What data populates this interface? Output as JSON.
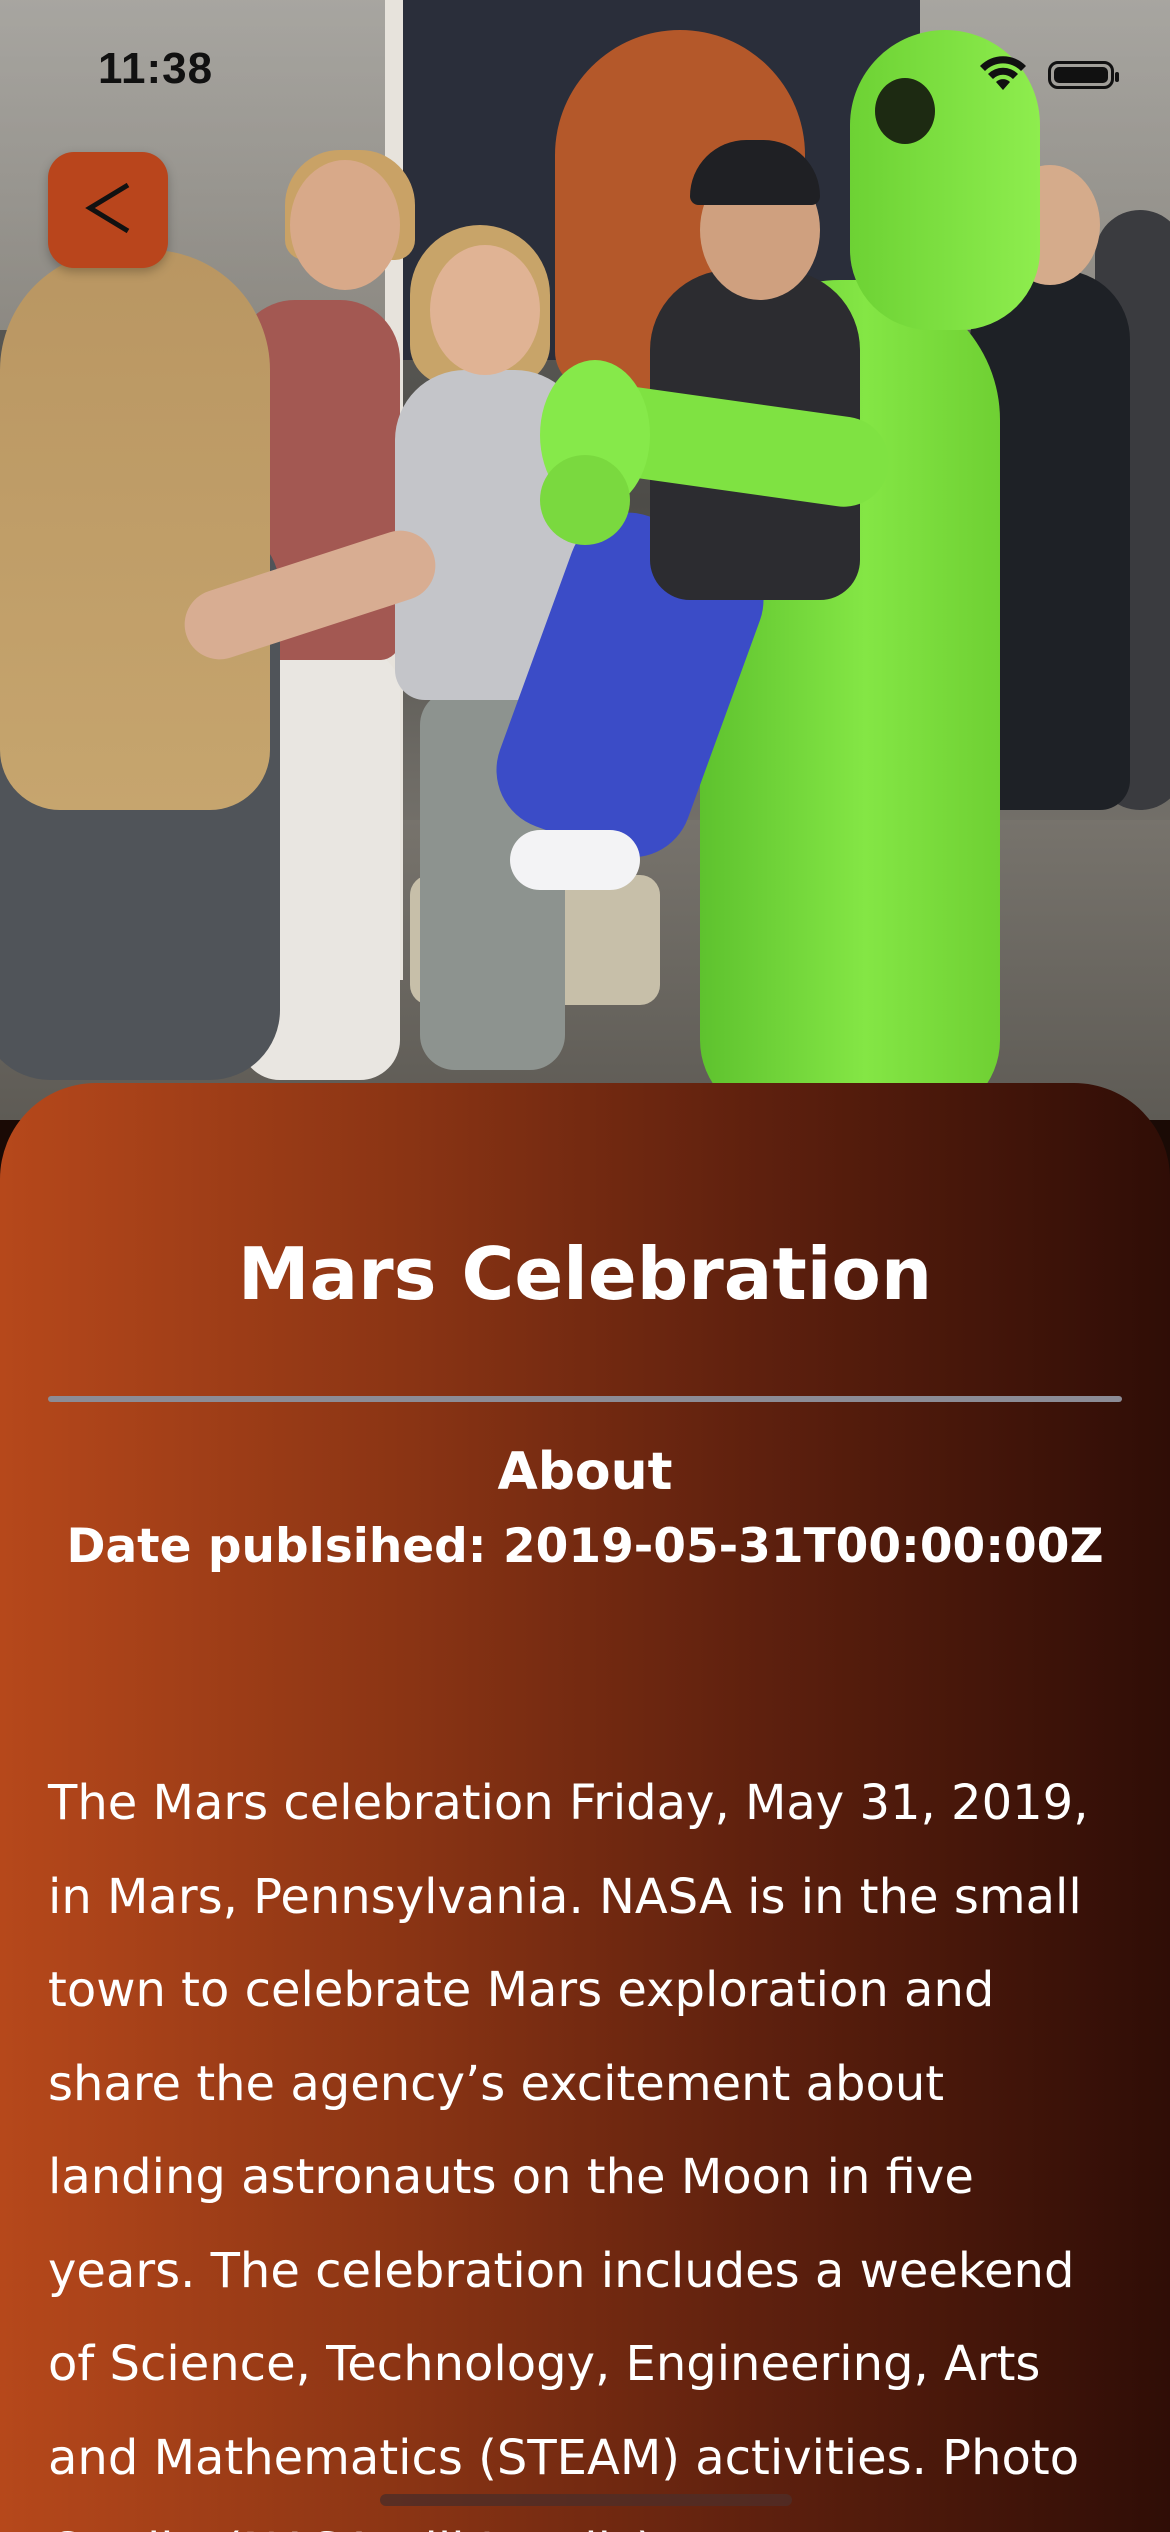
{
  "status_bar": {
    "time": "11:38",
    "wifi_icon": "wifi-icon",
    "battery_icon": "battery-icon"
  },
  "nav": {
    "back_icon": "chevron-left-icon",
    "back_color": "#b9451c"
  },
  "hero": {
    "image_subject": "person in inflatable green alien costume among crowd"
  },
  "detail": {
    "title": "Mars Celebration",
    "section_heading": "About",
    "date_label": "Date publsihed: 2019-05-31T00:00:00Z",
    "description": "The Mars celebration Friday, May 31, 2019, in Mars, Pennsylvania. NASA is in the small town to celebrate Mars exploration and share the agency’s excitement about landing astronauts on the Moon in five years. The celebration includes a weekend of Science, Technology, Engineering, Arts and Mathematics (STEAM) activities. Photo Credit: (NASA/Bill Ingalls)"
  },
  "colors": {
    "card_gradient_start": "#b6481b",
    "card_gradient_end": "#2f0d06",
    "divider": "#8c8c96",
    "text": "#ffffff"
  }
}
